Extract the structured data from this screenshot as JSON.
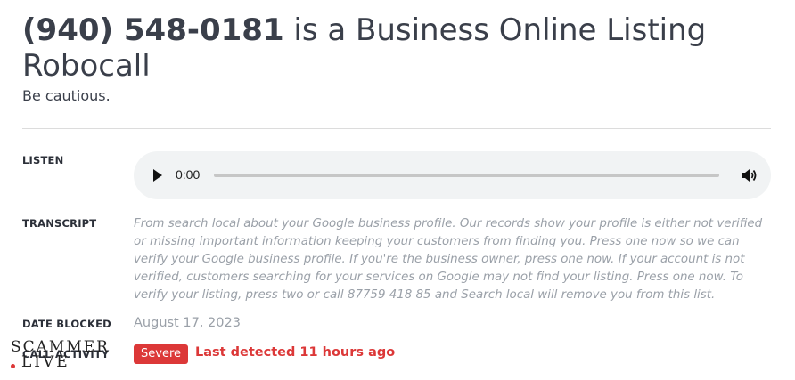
{
  "header": {
    "phone": "(940) 548-0181",
    "title_rest": " is a Business Online Listing Robocall",
    "subtitle": "Be cautious."
  },
  "labels": {
    "listen": "LISTEN",
    "transcript": "TRANSCRIPT",
    "date_blocked": "DATE BLOCKED",
    "call_activity": "CALL ACTIVITY"
  },
  "audio": {
    "current_time": "0:00",
    "progress": 0
  },
  "transcript": "From search local about your Google business profile. Our records show your profile is either not verified or missing important information keeping your customers from finding you. Press one now so we can verify your Google business profile. If you're the business owner, press one now. If your account is not verified, customers searching for your services on Google may not find your listing. Press one now. To verify your listing, press two or call 87759 418 85 and Search local will remove you from this list.",
  "date_blocked": "August 17, 2023",
  "activity": {
    "severity": "Severe",
    "last_detected": "Last detected 11 hours ago"
  },
  "logo": {
    "line1": "SCAMMER",
    "line2": "LIVE"
  },
  "colors": {
    "accent_red": "#dc3838",
    "text": "#3a3f4a",
    "muted": "#9aa0a8"
  },
  "icons": [
    "play-icon",
    "volume-icon"
  ]
}
